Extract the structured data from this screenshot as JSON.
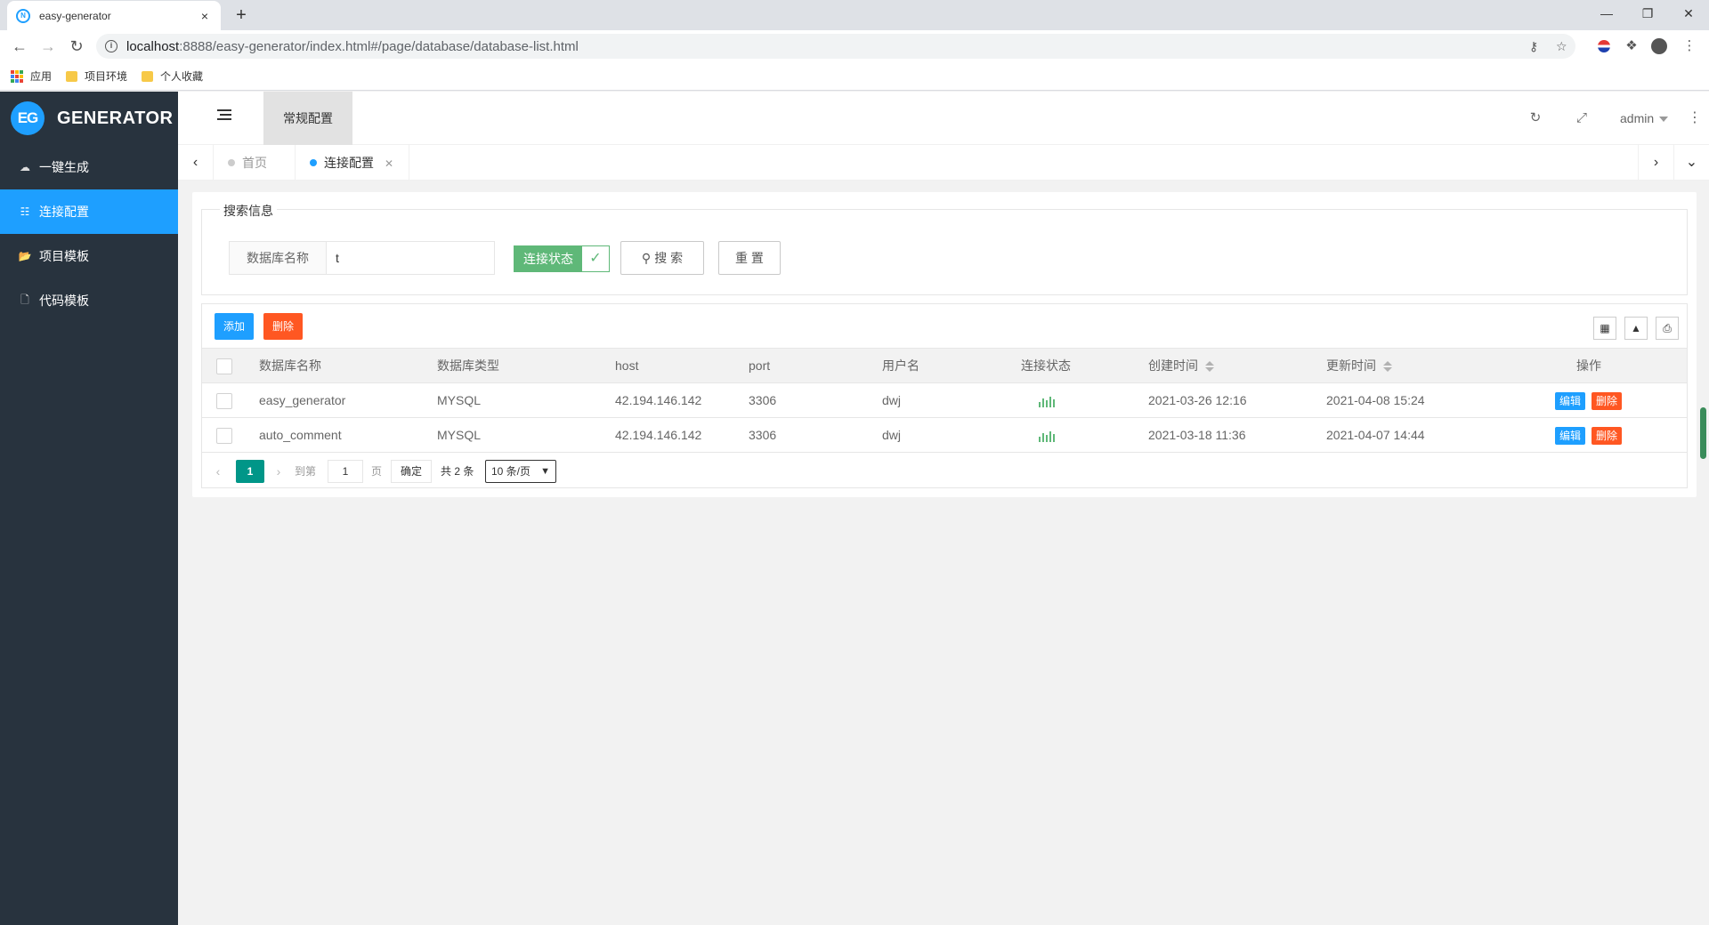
{
  "browser": {
    "tab_title": "easy-generator",
    "tab_close": "×",
    "new_tab": "+",
    "url_host": "localhost",
    "url_path": ":8888/easy-generator/index.html#/page/database/database-list.html",
    "bookmarks": [
      {
        "label": "应用",
        "icon": "apps-icon"
      },
      {
        "label": "项目环境",
        "icon": "folder-icon"
      },
      {
        "label": "个人收藏",
        "icon": "folder-icon"
      }
    ]
  },
  "sidebar": {
    "logo_badge": "EG",
    "logo_text": "GENERATOR",
    "items": [
      {
        "label": "一键生成",
        "icon": "cloud-icon",
        "active": false
      },
      {
        "label": "连接配置",
        "icon": "sitemap-icon",
        "active": true
      },
      {
        "label": "项目模板",
        "icon": "folder-open-icon",
        "active": false
      },
      {
        "label": "代码模板",
        "icon": "code-file-icon",
        "active": false
      }
    ]
  },
  "header": {
    "tab_label": "常规配置",
    "user": "admin"
  },
  "page_tabs": [
    {
      "label": "首页",
      "active": false
    },
    {
      "label": "连接配置",
      "active": true
    }
  ],
  "search": {
    "legend": "搜索信息",
    "field_label": "数据库名称",
    "field_value": "t",
    "status_label": "连接状态",
    "search_button": "搜 索",
    "reset_button": "重 置"
  },
  "table": {
    "add_button": "添加",
    "delete_button": "删除",
    "columns": [
      "数据库名称",
      "数据库类型",
      "host",
      "port",
      "用户名",
      "连接状态",
      "创建时间",
      "更新时间",
      "操作"
    ],
    "rows": [
      {
        "name": "easy_generator",
        "type": "MYSQL",
        "host": "42.194.146.142",
        "port": "3306",
        "user": "dwj",
        "created": "2021-03-26 12:16",
        "updated": "2021-04-08 15:24"
      },
      {
        "name": "auto_comment",
        "type": "MYSQL",
        "host": "42.194.146.142",
        "port": "3306",
        "user": "dwj",
        "created": "2021-03-18 11:36",
        "updated": "2021-04-07 14:44"
      }
    ],
    "edit_label": "编辑",
    "delete_label": "删除"
  },
  "pager": {
    "current": "1",
    "goto_label": "到第",
    "goto_value": "1",
    "page_label": "页",
    "confirm_label": "确定",
    "total_label": "共 2 条",
    "page_size": "10 条/页"
  },
  "colors": {
    "primary": "#1e9fff",
    "danger": "#ff5722",
    "success": "#5fb878",
    "teal": "#009688",
    "sidebar_bg": "#28333e"
  }
}
